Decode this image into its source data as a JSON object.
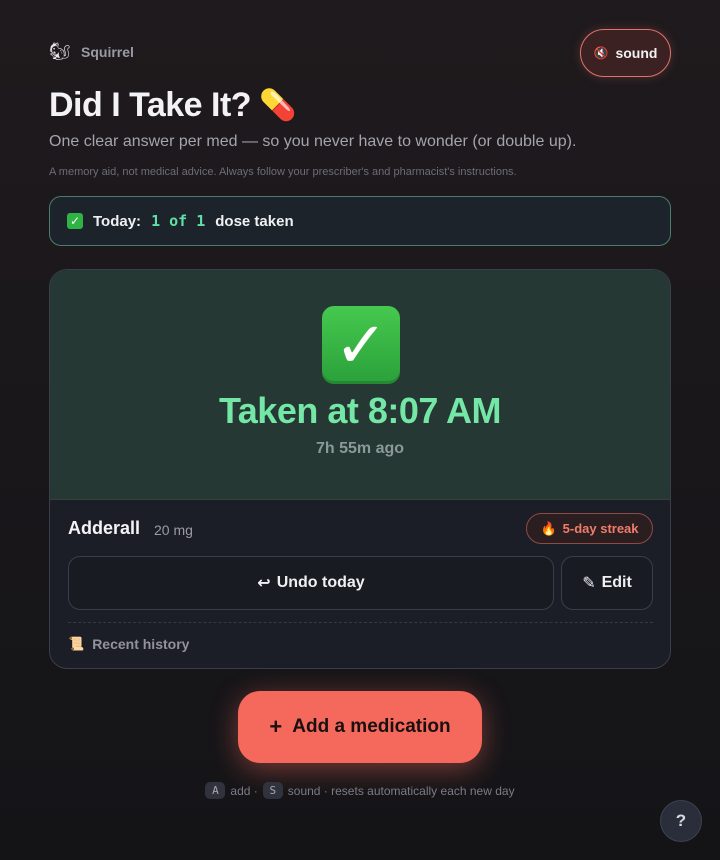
{
  "brand": {
    "emoji": "🐿",
    "name": "Squirrel"
  },
  "sound_button": {
    "icon": "🔇",
    "label": "sound"
  },
  "header": {
    "title": "Did I Take It?",
    "title_emoji": "💊",
    "subtitle": "One clear answer per med — so you never have to wonder (or double up).",
    "disclaimer": "A memory aid, not medical advice. Always follow your prescriber's and pharmacist's instructions."
  },
  "today": {
    "icon": "✓",
    "label": "Today:",
    "count": "1 of 1",
    "suffix": "dose taken"
  },
  "med": {
    "status_icon": "✓",
    "taken_text": "Taken at 8:07 AM",
    "ago": "7h 55m ago",
    "name": "Adderall",
    "dose": "20 mg",
    "streak_icon": "🔥",
    "streak_label": "5-day streak",
    "undo_icon": "↩",
    "undo_label": "Undo today",
    "edit_icon": "✎",
    "edit_label": "Edit",
    "history_icon": "📜",
    "history_label": "Recent history"
  },
  "add_button": {
    "icon": "+",
    "label": "Add a medication"
  },
  "shortcuts": {
    "key_add": "A",
    "add_text": "add ·",
    "key_sound": "S",
    "sound_text": "sound · resets automatically each new day"
  },
  "help_button": {
    "label": "?"
  },
  "colors": {
    "accent": "#f4695b",
    "taken_green": "#74e6a6",
    "mono_green": "#5fe0a5",
    "streak": "#ef7d6a"
  }
}
